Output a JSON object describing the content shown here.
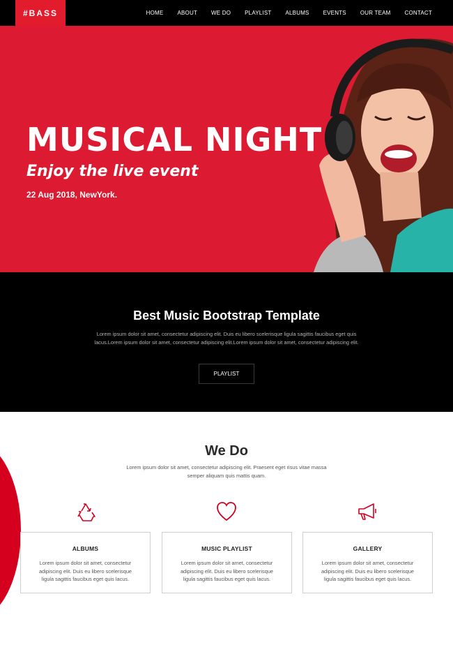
{
  "brand": {
    "logo": "#BASS",
    "accent": "#dc1a31"
  },
  "nav": {
    "items": [
      {
        "label": "HOME"
      },
      {
        "label": "ABOUT"
      },
      {
        "label": "WE DO"
      },
      {
        "label": "PLAYLIST"
      },
      {
        "label": "ALBUMS"
      },
      {
        "label": "EVENTS"
      },
      {
        "label": "OUR TEAM"
      },
      {
        "label": "CONTACT"
      }
    ]
  },
  "hero": {
    "title": "MUSICAL NIGHT",
    "subtitle": "Enjoy the live event",
    "date": "22 Aug 2018, NewYork."
  },
  "intro": {
    "title": "Best Music Bootstrap Template",
    "text": "Lorem ipsum dolor sit amet, consectetur adipiscing elit. Duis eu libero scelerisque ligula sagittis faucibus eget quis lacus.Lorem ipsum dolor sit amet, consectetur adipiscing elit.Lorem ipsum dolor sit amet, consectetur adipiscing elit.",
    "button": "PLAYLIST"
  },
  "wedo": {
    "title": "We Do",
    "text": "Lorem ipsum dolor sit amet, consectetur adipiscing elit. Praesent eget risus vitae massa semper aliquam quis mattis quam.",
    "cards": [
      {
        "title": "ALBUMS",
        "text": "Lorem ipsum dolor sit amet, consectetur adipiscing elit. Duis eu libero scelerisque ligula sagittis faucibus eget quis lacus.",
        "icon": "recycle-icon"
      },
      {
        "title": "MUSIC PLAYLIST",
        "text": "Lorem ipsum dolor sit amet, consectetur adipiscing elit. Duis eu libero scelerisque ligula sagittis faucibus eget quis lacus.",
        "icon": "heart-icon"
      },
      {
        "title": "GALLERY",
        "text": "Lorem ipsum dolor sit amet, consectetur adipiscing elit. Duis eu libero scelerisque ligula sagittis faucibus eget quis lacus.",
        "icon": "megaphone-icon"
      }
    ]
  }
}
